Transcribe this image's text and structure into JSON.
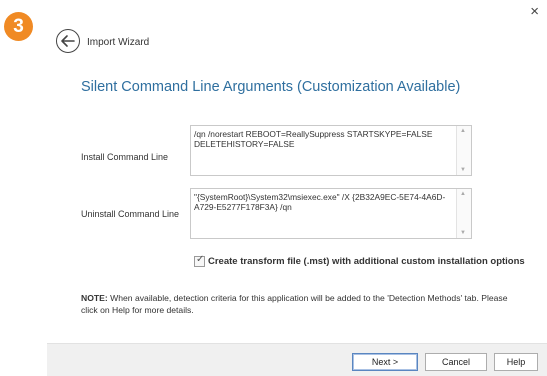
{
  "step": {
    "number": "3"
  },
  "dialog": {
    "back_icon": "arrow-left-icon",
    "title": "Import Wizard",
    "close_glyph": "×"
  },
  "section": {
    "title": "Silent Command Line Arguments (Customization Available)"
  },
  "install": {
    "label": "Install Command Line",
    "value": "/qn /norestart REBOOT=ReallySuppress STARTSKYPE=FALSE DELETEHISTORY=FALSE"
  },
  "uninstall": {
    "label": "Uninstall Command Line",
    "value": "\"{SystemRoot}\\System32\\msiexec.exe\" /X {2B32A9EC-5E74-4A6D-A729-E5277F178F3A} /qn"
  },
  "transform": {
    "checked": true,
    "label": "Create transform file (.mst) with additional custom installation options"
  },
  "note": {
    "prefix": "NOTE:",
    "text": " When available, detection criteria for this application will be added to the 'Detection Methods' tab. Please click on Help for more details."
  },
  "footer": {
    "next_label": "Next >",
    "cancel_label": "Cancel",
    "help_label": "Help"
  },
  "colors": {
    "accent": "#2f6f9f",
    "step_badge": "#f08a24"
  }
}
